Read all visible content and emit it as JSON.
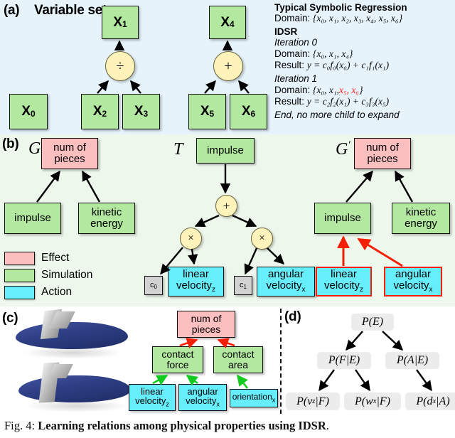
{
  "figure": {
    "caption_prefix": "Fig. 4:",
    "caption_bold": "Learning relations among physical properties using IDSR",
    "caption_suffix": "."
  },
  "panel_a": {
    "label": "(a)",
    "title": "Variable set",
    "background": "#e6f3fb",
    "nodes": [
      {
        "id": "x0",
        "label": "X",
        "sub": "0",
        "type": "variable"
      },
      {
        "id": "x1",
        "label": "X",
        "sub": "1",
        "type": "variable"
      },
      {
        "id": "x2",
        "label": "X",
        "sub": "2",
        "type": "variable"
      },
      {
        "id": "x3",
        "label": "X",
        "sub": "3",
        "type": "variable"
      },
      {
        "id": "x4",
        "label": "X",
        "sub": "4",
        "type": "variable"
      },
      {
        "id": "x5",
        "label": "X",
        "sub": "5",
        "type": "variable"
      },
      {
        "id": "x6",
        "label": "X",
        "sub": "6",
        "type": "variable"
      }
    ],
    "operators": [
      {
        "id": "op-div",
        "symbol": "÷"
      },
      {
        "id": "op-plus",
        "symbol": "+"
      }
    ],
    "text": {
      "heading_typical": "Typical Symbolic Regression",
      "typical_domain_label": "Domain:",
      "typical_domain_set": "{x₀, x₁, x₂, x₃, x₄, x₅, x₆}",
      "heading_idsr": "IDSR",
      "iteration0_label": "Iteration 0",
      "iteration0_domain_label": "Domain:",
      "iteration0_domain_set": "{x₀, x₁, x₄}",
      "iteration0_result_label": "Result:",
      "iteration0_result": "y = c₀f₀(x₀) + c₁f₁(x₁)",
      "iteration1_label": "Iteration 1",
      "iteration1_domain_label": "Domain:",
      "iteration1_domain_black": "{x₀, x₁,",
      "iteration1_domain_red": "x₅, x₆",
      "iteration1_domain_close": "}",
      "iteration1_result_label": "Result:",
      "iteration1_result": "y = c₂f₂(x₁) + c₃f₃(x₅)",
      "end_note": "End, no more child to expand"
    }
  },
  "panel_b": {
    "label": "(b)",
    "background": "#edf7ec",
    "graph_g": {
      "symbol": "G",
      "effect_node": "num of pieces",
      "sim_nodes": [
        "impulse",
        "kinetic energy"
      ]
    },
    "tree_t": {
      "symbol": "T",
      "root": "impulse",
      "operators": [
        "+",
        "×",
        "×"
      ],
      "constants": [
        "c",
        "c"
      ],
      "constant_subs": [
        "0",
        "1"
      ],
      "leaves": [
        "linear velocity",
        "angular velocity"
      ],
      "leaf_subs": [
        "z",
        "x"
      ]
    },
    "graph_g_prime": {
      "symbol": "G",
      "prime": "′",
      "effect_node": "num of pieces",
      "sim_nodes": [
        "impulse",
        "kinetic energy"
      ],
      "action_nodes": [
        "linear velocity",
        "angular velocity"
      ],
      "action_subs": [
        "z",
        "x"
      ],
      "highlight_color": "#f41f05"
    },
    "legend": [
      {
        "name": "Effect",
        "color": "#fbbfc0"
      },
      {
        "name": "Simulation",
        "color": "#b3e8a0"
      },
      {
        "name": "Action",
        "color": "#66eefc"
      }
    ]
  },
  "panel_c": {
    "label": "(c)",
    "effect_node": "num of pieces",
    "sim_nodes": [
      "contact force",
      "contact area"
    ],
    "action_nodes": [
      "linear velocity",
      "angular velocity",
      "orientation"
    ],
    "action_subs": [
      "z",
      "x",
      "x"
    ],
    "effect_arrow_color": "#f41f05",
    "sim_arrow_color": "#11cc1f"
  },
  "panel_d": {
    "label": "(d)",
    "nodes": [
      {
        "id": "pe",
        "text": "P(E)"
      },
      {
        "id": "pfe",
        "text": "P(F|E)"
      },
      {
        "id": "pae",
        "text": "P(A|E)"
      },
      {
        "id": "pvf",
        "text": "P(v",
        "sub": "z",
        "tail": "|F)"
      },
      {
        "id": "pwf",
        "text": "P(w",
        "sub": "x",
        "tail": "|F)"
      },
      {
        "id": "pda",
        "text": "P(d",
        "sub": "x",
        "tail": "|A)"
      }
    ]
  }
}
